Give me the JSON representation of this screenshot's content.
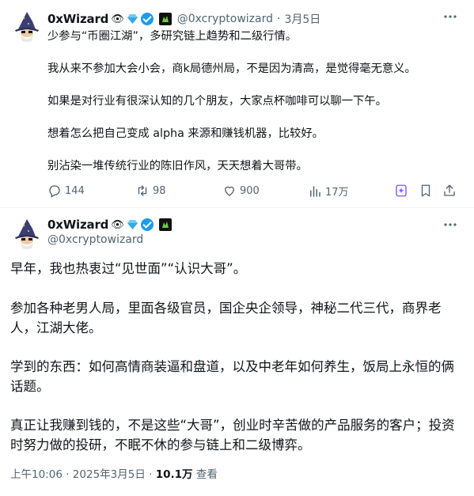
{
  "quoted_tweet": {
    "display_name": "0xWizard",
    "handle": "@0xcryptowizard",
    "date": "3月5日",
    "separator": "·",
    "paragraphs": [
      "少参与“币圈江湖”，多研究链上趋势和二级行情。",
      "我从来不参加大会小会，商k局德州局，不是因为清高，是觉得毫无意义。",
      "如果是对行业有很深认知的几个朋友，大家点杯咖啡可以聊一下午。",
      "想着怎么把自己变成 alpha 来源和赚钱机器，比较好。",
      "别沾染一堆传统行业的陈旧作风，天天想着大哥带。"
    ],
    "actions": {
      "replies": "144",
      "retweets": "98",
      "likes": "900",
      "views": "17万"
    }
  },
  "main_tweet": {
    "display_name": "0xWizard",
    "handle": "@0xcryptowizard",
    "paragraphs": [
      "早年，我也热衷过“见世面”“认识大哥”。",
      "参加各种老男人局，里面各级官员，国企央企领导，神秘二代三代，商界老人，江湖大佬。",
      "学到的东西：如何高情商装逼和盘道，以及中老年如何养生，饭局上永恒的俩话题。",
      "真正让我赚到钱的，不是这些“大哥”，创业时辛苦做的产品服务的客户；投资时努力做的投研，不眠不休的参与链上和二级博弈。"
    ],
    "meta": {
      "time": "上午10:06",
      "separator": "·",
      "date": "2025年3月5日",
      "views_count": "10.1万",
      "views_label": "查看"
    }
  },
  "icons": [
    "wizard-avatar",
    "eye-emoji",
    "diamond-emoji",
    "verified-badge",
    "affiliate-badge",
    "more-icon",
    "reply-icon",
    "retweet-icon",
    "like-icon",
    "views-icon",
    "grok-icon",
    "bookmark-icon",
    "share-icon"
  ],
  "colors": {
    "text": "#0f1419",
    "muted": "#536471",
    "verified": "#1d9bf0",
    "divider": "#eff3f4",
    "grok": "#7856ff"
  }
}
